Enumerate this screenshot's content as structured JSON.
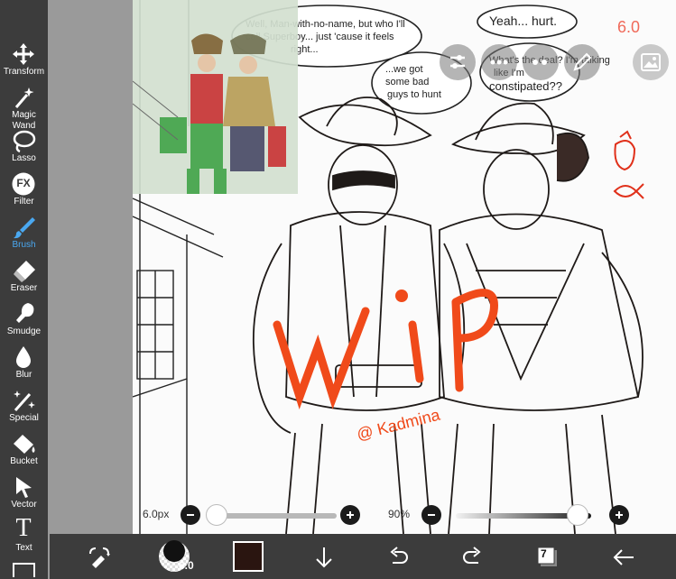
{
  "toolbar": {
    "tools": [
      {
        "label": "Transform",
        "icon": "move-arrows-icon"
      },
      {
        "label": "Magic Wand",
        "icon": "magic-wand-icon"
      },
      {
        "label": "Lasso",
        "icon": "lasso-icon"
      },
      {
        "label": "Filter",
        "icon": "fx-icon",
        "glyph": "FX"
      },
      {
        "label": "Brush",
        "icon": "brush-icon",
        "active": true
      },
      {
        "label": "Eraser",
        "icon": "eraser-icon"
      },
      {
        "label": "Smudge",
        "icon": "smudge-icon"
      },
      {
        "label": "Blur",
        "icon": "blur-drop-icon"
      },
      {
        "label": "Special",
        "icon": "special-wand-icon"
      },
      {
        "label": "Bucket",
        "icon": "bucket-icon"
      },
      {
        "label": "Vector",
        "icon": "vector-cursor-icon"
      },
      {
        "label": "Text",
        "icon": "text-t-icon",
        "glyph": "T"
      }
    ]
  },
  "artwork": {
    "speech_bubble_1": "Well, Man-with-no-name, but who I'll call Superboy... just 'cause it feels right...",
    "speech_bubble_2": "...we got some bad guys to hunt",
    "speech_bubble_3": "Yeah... hurt.",
    "speech_bubble_4": "What's the deal? I'm talking like I'm constipated??",
    "corner_note": "6.0",
    "watermark": "WIP",
    "signature": "@ Kadmina"
  },
  "brush_controls": {
    "size_value": "6.0px",
    "size_fraction": 0.02,
    "opacity_value": "90%",
    "opacity_fraction": 0.9
  },
  "bottom_bar": {
    "brush_size_badge": "6.0",
    "current_color": "#2a1510",
    "layer_count": "7"
  },
  "colors": {
    "toolbar_bg": "#3c3c3c",
    "active_tool": "#4aa8f0",
    "wip_red": "#f04a1a"
  }
}
